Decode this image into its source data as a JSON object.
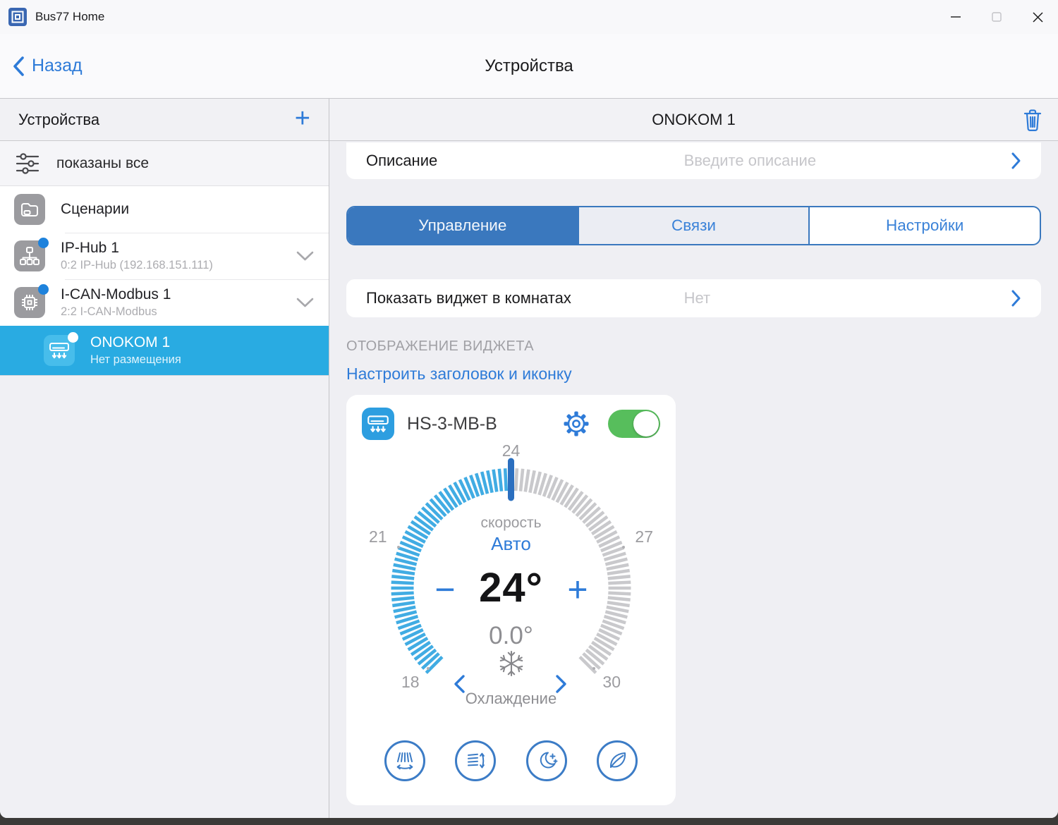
{
  "titlebar": {
    "app_title": "Bus77 Home",
    "app_icon": "bus77-app-icon",
    "window_controls": [
      "minimize-icon",
      "maximize-icon",
      "close-icon"
    ]
  },
  "nav": {
    "back_label": "Назад",
    "back_icon": "chevron-left-icon",
    "title": "Устройства"
  },
  "sidebar": {
    "header": {
      "title": "Устройства",
      "add_label": "+"
    },
    "filter": {
      "icon": "sliders-icon",
      "label": "показаны все"
    },
    "items": [
      {
        "title": "Сценарии",
        "subtitle": "",
        "icon": "folder-icon",
        "badge": false,
        "expandable": false,
        "selected": false
      },
      {
        "title": "IP-Hub 1",
        "subtitle": "0:2 IP-Hub (192.168.151.111)",
        "icon": "hub-icon",
        "badge": true,
        "expandable": true,
        "selected": false
      },
      {
        "title": "I-CAN-Modbus 1",
        "subtitle": "2:2 I-CAN-Modbus",
        "icon": "chip-icon",
        "badge": true,
        "expandable": true,
        "selected": false
      },
      {
        "title": "ONOKOM 1",
        "subtitle": "Нет размещения",
        "icon": "ac-unit-icon",
        "badge": true,
        "expandable": false,
        "selected": true
      }
    ]
  },
  "panel": {
    "title": "ONOKOM 1",
    "delete_icon": "trash-icon",
    "description_row": {
      "label": "Описание",
      "placeholder": "Введите описание"
    },
    "tabs": [
      {
        "label": "Управление",
        "active": true
      },
      {
        "label": "Связи",
        "active": false
      },
      {
        "label": "Настройки",
        "active": false
      }
    ],
    "widget_room_row": {
      "label": "Показать виджет в комнатах",
      "value": "Нет"
    },
    "section_label": "ОТОБРАЖЕНИЕ ВИДЖЕТА",
    "configure_link": "Настроить заголовок и иконку",
    "widget": {
      "title": "HS-3-MB-B",
      "icon": "ac-unit-icon",
      "settings_icon": "gear-icon",
      "toggle_on": true,
      "dial": {
        "min": 18,
        "max": 30,
        "value": 24,
        "scale_labels": [
          "18",
          "21",
          "24",
          "27",
          "30"
        ],
        "speed_label": "скорость",
        "speed_value": "Авто",
        "temp_display": "24°",
        "current_temp": "0.0°",
        "minus_label": "−",
        "plus_label": "+",
        "mode_icon": "snowflake-icon",
        "mode_label": "Охлаждение"
      },
      "mode_buttons": [
        "swing-horizontal-icon",
        "swing-vertical-icon",
        "sleep-mode-icon",
        "eco-mode-icon"
      ]
    }
  },
  "colors": {
    "accent_blue": "#2E7BD8",
    "tab_blue": "#3A78BE",
    "selected_row_blue": "#29ABE2",
    "toggle_green": "#57BE5C",
    "tick_blue": "#41ACE3",
    "tick_gray": "#C9C9CC",
    "marker_blue": "#2B6FBF"
  }
}
